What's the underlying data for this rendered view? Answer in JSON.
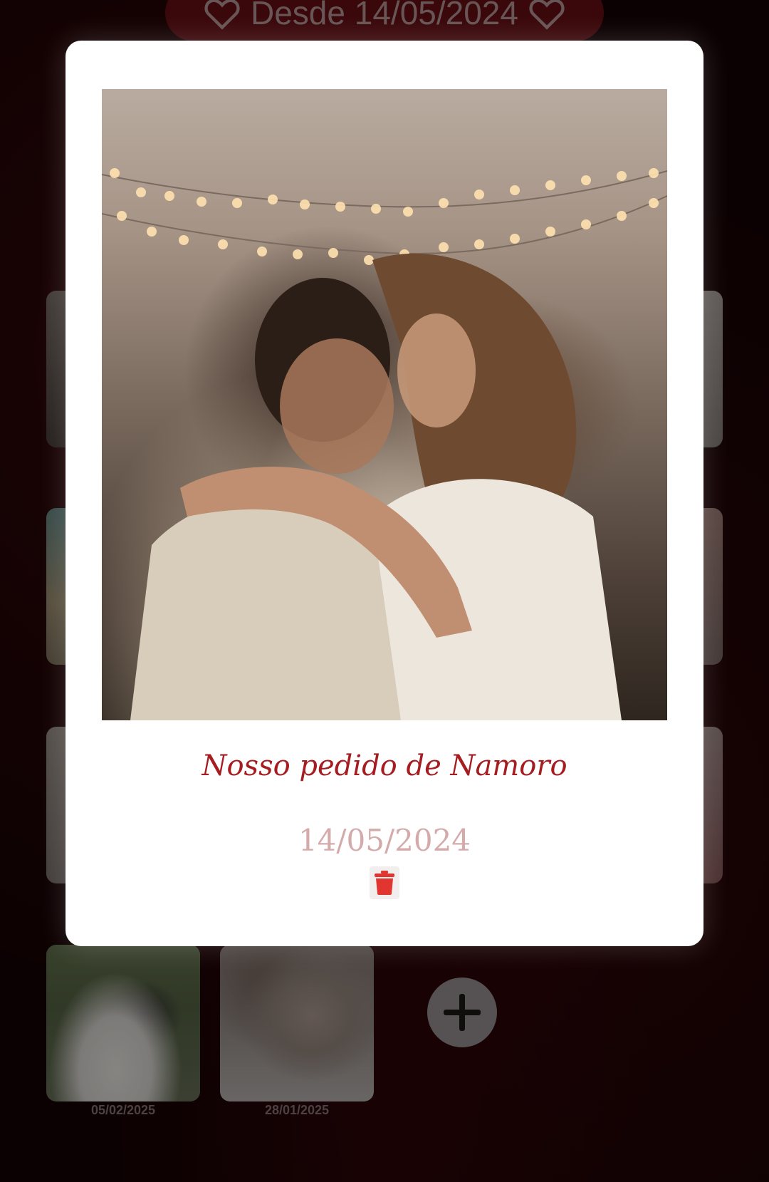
{
  "header": {
    "since_label": "Desde 14/05/2024"
  },
  "gallery": {
    "bottom_dates": [
      "05/02/2025",
      "28/01/2025"
    ]
  },
  "modal": {
    "caption": "Nosso pedido de Namoro",
    "date": "14/05/2024"
  },
  "icons": {
    "header_left": "heart-outline-icon",
    "header_right": "heart-outline-icon",
    "delete": "trash-icon",
    "add": "plus-icon"
  },
  "colors": {
    "accent": "#a61d21",
    "delete": "#e0362f",
    "background": "#140304"
  }
}
